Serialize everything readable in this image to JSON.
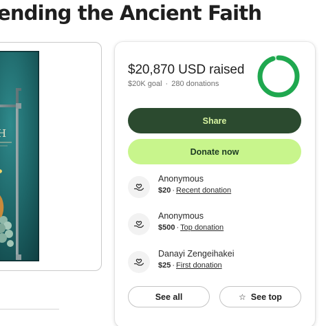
{
  "page": {
    "title": "ending the Ancient Faith"
  },
  "cover": {
    "visible_text": "TH"
  },
  "progress": {
    "raised_text": "$20,870 USD raised",
    "goal_text": "$20K goal",
    "donations_text": "280 donations",
    "ring_fraction": 0.95
  },
  "actions": {
    "share_label": "Share",
    "donate_label": "Donate now"
  },
  "donations": [
    {
      "name": "Anonymous",
      "amount": "$20",
      "kind": "Recent donation"
    },
    {
      "name": "Anonymous",
      "amount": "$500",
      "kind": "Top donation"
    },
    {
      "name": "Danayi Zengeihakei",
      "amount": "$25",
      "kind": "First donation"
    }
  ],
  "footer_buttons": {
    "see_all_label": "See all",
    "see_top_label": "See top"
  },
  "colors": {
    "share_bg": "#2b4a2f",
    "share_text": "#d8f5a2",
    "donate_bg": "#c8f58c",
    "ring_progress": "#1fa84f",
    "ring_track": "#d4f2dc"
  },
  "icons": {
    "donation": "hand-heart-icon",
    "see_top": "star-icon"
  }
}
